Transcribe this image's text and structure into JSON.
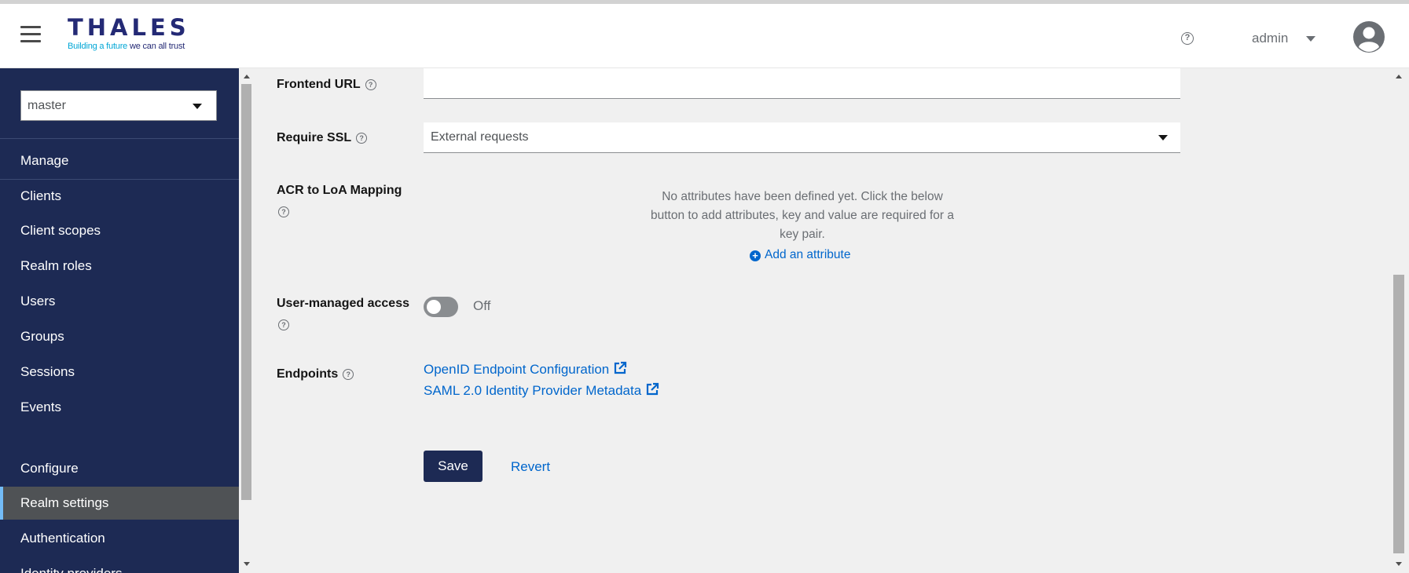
{
  "header": {
    "logo_word": "THALES",
    "logo_tagline_prefix": "Building a future",
    "logo_tagline_suffix": " we can all trust",
    "username": "admin"
  },
  "sidebar": {
    "realm": "master",
    "manage_label": "Manage",
    "manage_items": [
      {
        "label": "Clients"
      },
      {
        "label": "Client scopes"
      },
      {
        "label": "Realm roles"
      },
      {
        "label": "Users"
      },
      {
        "label": "Groups"
      },
      {
        "label": "Sessions"
      },
      {
        "label": "Events"
      }
    ],
    "configure_label": "Configure",
    "configure_items": [
      {
        "label": "Realm settings",
        "active": true
      },
      {
        "label": "Authentication"
      },
      {
        "label": "Identity providers"
      }
    ]
  },
  "form": {
    "frontend_url": {
      "label": "Frontend URL",
      "value": ""
    },
    "require_ssl": {
      "label": "Require SSL",
      "value": "External requests"
    },
    "acr_mapping": {
      "label": "ACR to LoA Mapping",
      "empty_text": "No attributes have been defined yet. Click the below button to add attributes, key and value are required for a key pair.",
      "add_label": "Add an attribute"
    },
    "user_managed_access": {
      "label": "User-managed access",
      "state": "Off"
    },
    "endpoints": {
      "label": "Endpoints",
      "links": [
        {
          "label": "OpenID Endpoint Configuration"
        },
        {
          "label": "SAML 2.0 Identity Provider Metadata"
        }
      ]
    },
    "save_label": "Save",
    "revert_label": "Revert"
  },
  "colors": {
    "sidebar_bg": "#1d2a54",
    "active_item_bg": "#4f5255",
    "active_accent": "#73bcf7",
    "link": "#0066cc",
    "primary_button": "#1d2a54",
    "brand_blue": "#242a75",
    "brand_cyan": "#00a6d6"
  },
  "icons": {
    "menu": "hamburger-icon",
    "help": "question-circle-icon",
    "user_caret": "caret-down-icon",
    "avatar": "user-avatar-icon",
    "add": "plus-circle-icon",
    "external": "external-link-icon"
  }
}
